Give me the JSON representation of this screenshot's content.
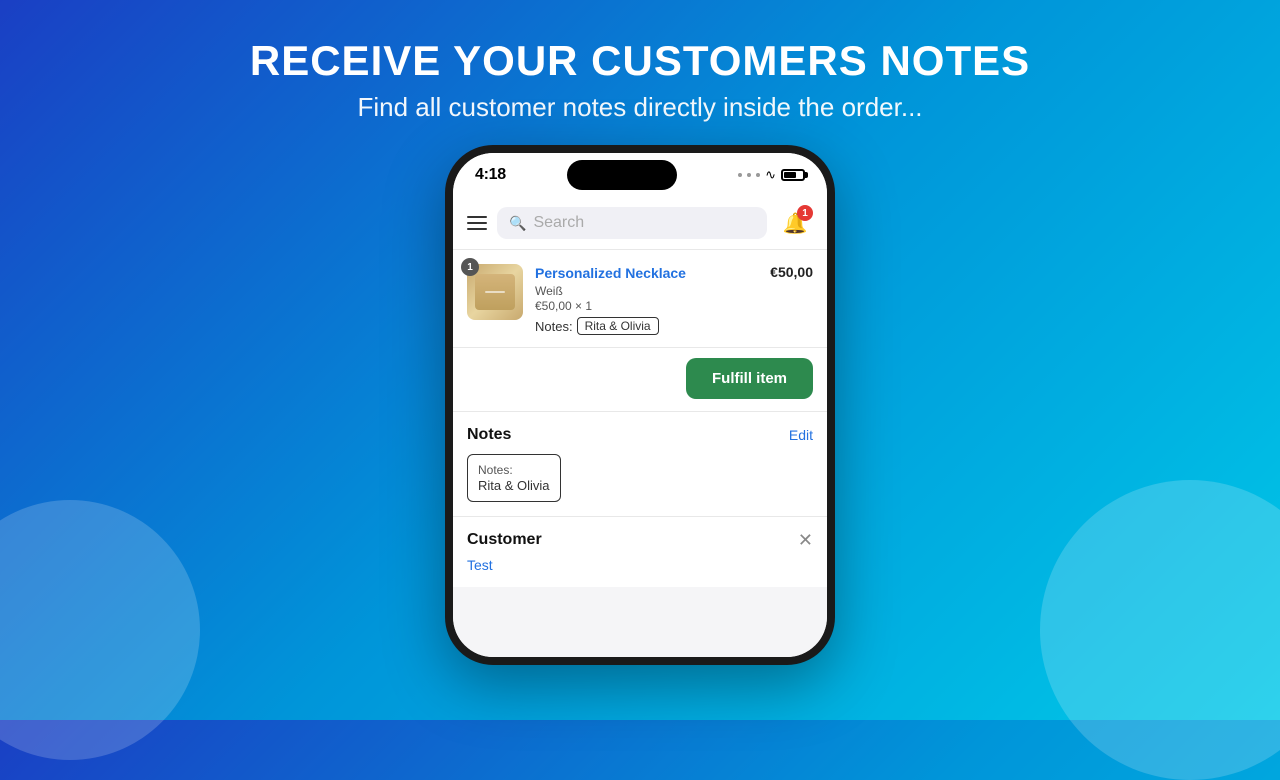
{
  "background": {
    "gradient_start": "#1a3fc4",
    "gradient_end": "#00c8e8"
  },
  "header": {
    "main_title": "RECEIVE YOUR CUSTOMERS NOTES",
    "sub_title": "Find all customer notes directly inside the order..."
  },
  "phone": {
    "status_bar": {
      "time": "4:18",
      "notif_count": "1"
    },
    "search_placeholder": "Search",
    "order_item": {
      "qty": "1",
      "product_name": "Personalized Necklace",
      "variant": "Weiß",
      "price_qty": "€50,00 × 1",
      "notes_label": "Notes:",
      "notes_value": "Rita & Olivia",
      "total": "€50,00"
    },
    "fulfill_button": "Fulfill item",
    "notes_section": {
      "title": "Notes",
      "edit_label": "Edit",
      "notes_label": "Notes:",
      "notes_value": "Rita & Olivia"
    },
    "customer_section": {
      "title": "Customer",
      "customer_name": "Test"
    }
  }
}
